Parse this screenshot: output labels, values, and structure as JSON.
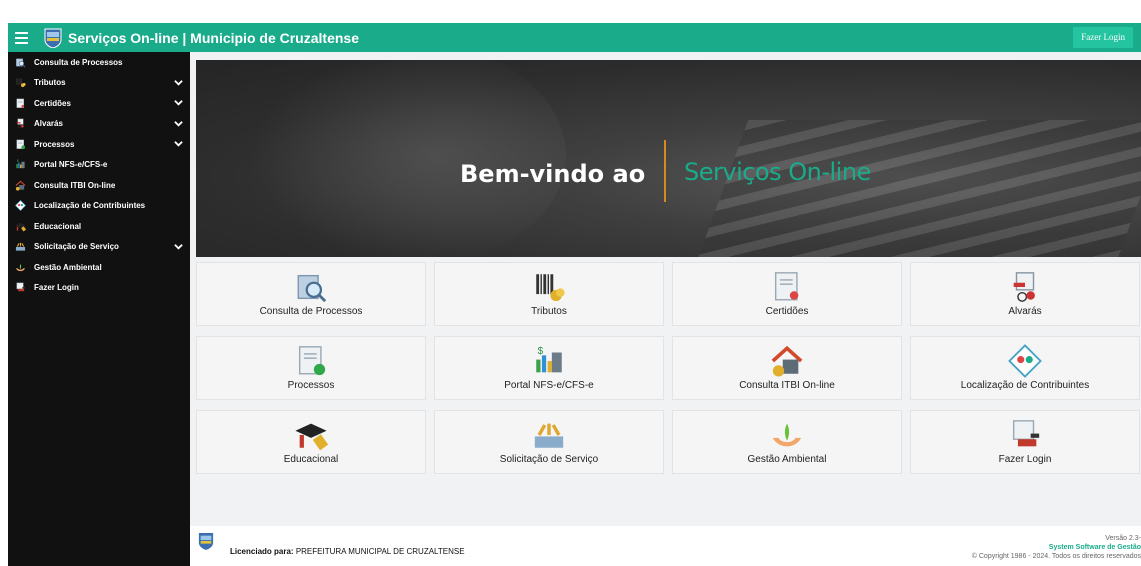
{
  "header": {
    "title": "Serviços On-line | Municipio de Cruzaltense",
    "login_label": "Fazer Login"
  },
  "sidebar": {
    "items": [
      {
        "label": "Consulta de Processos",
        "icon": "search-document-icon",
        "has_submenu": false
      },
      {
        "label": "Tributos",
        "icon": "barcode-icon",
        "has_submenu": true
      },
      {
        "label": "Certidões",
        "icon": "certificate-icon",
        "has_submenu": true
      },
      {
        "label": "Alvarás",
        "icon": "permit-icon",
        "has_submenu": true
      },
      {
        "label": "Processos",
        "icon": "process-icon",
        "has_submenu": true
      },
      {
        "label": "Portal NFS-e/CFS-e",
        "icon": "invoice-icon",
        "has_submenu": false
      },
      {
        "label": "Consulta ITBI On-line",
        "icon": "house-icon",
        "has_submenu": false
      },
      {
        "label": "Localização de Contribuintes",
        "icon": "location-icon",
        "has_submenu": false
      },
      {
        "label": "Educacional",
        "icon": "graduation-icon",
        "has_submenu": false
      },
      {
        "label": "Solicitação de Serviço",
        "icon": "tools-icon",
        "has_submenu": true
      },
      {
        "label": "Gestão Ambiental",
        "icon": "plant-icon",
        "has_submenu": false
      },
      {
        "label": "Fazer Login",
        "icon": "login-icon",
        "has_submenu": false
      }
    ]
  },
  "banner": {
    "welcome": "Bem-vindo ao",
    "service": "Serviços On-line"
  },
  "tiles": [
    {
      "label": "Consulta de Processos",
      "icon": "search-document-icon"
    },
    {
      "label": "Tributos",
      "icon": "barcode-icon"
    },
    {
      "label": "Certidões",
      "icon": "certificate-icon"
    },
    {
      "label": "Alvarás",
      "icon": "permit-icon"
    },
    {
      "label": "Processos",
      "icon": "process-icon"
    },
    {
      "label": "Portal NFS-e/CFS-e",
      "icon": "invoice-icon"
    },
    {
      "label": "Consulta ITBI On-line",
      "icon": "house-icon"
    },
    {
      "label": "Localização de Contribuintes",
      "icon": "location-icon"
    },
    {
      "label": "Educacional",
      "icon": "graduation-icon"
    },
    {
      "label": "Solicitação de Serviço",
      "icon": "tools-icon"
    },
    {
      "label": "Gestão Ambiental",
      "icon": "plant-icon"
    },
    {
      "label": "Fazer Login",
      "icon": "login-icon"
    }
  ],
  "footer": {
    "licensed_prefix": "Licenciado para:",
    "licensed_to": "PREFEITURA MUNICIPAL DE CRUZALTENSE",
    "version": "Versão 2.3-",
    "system": "System Software de Gestão",
    "copyright": "© Copyright 1986 - 2024. Todos os direitos reservados"
  },
  "colors": {
    "accent": "#1aab8b",
    "sidebar_bg": "#111111",
    "banner_divider": "#d88a1c"
  }
}
